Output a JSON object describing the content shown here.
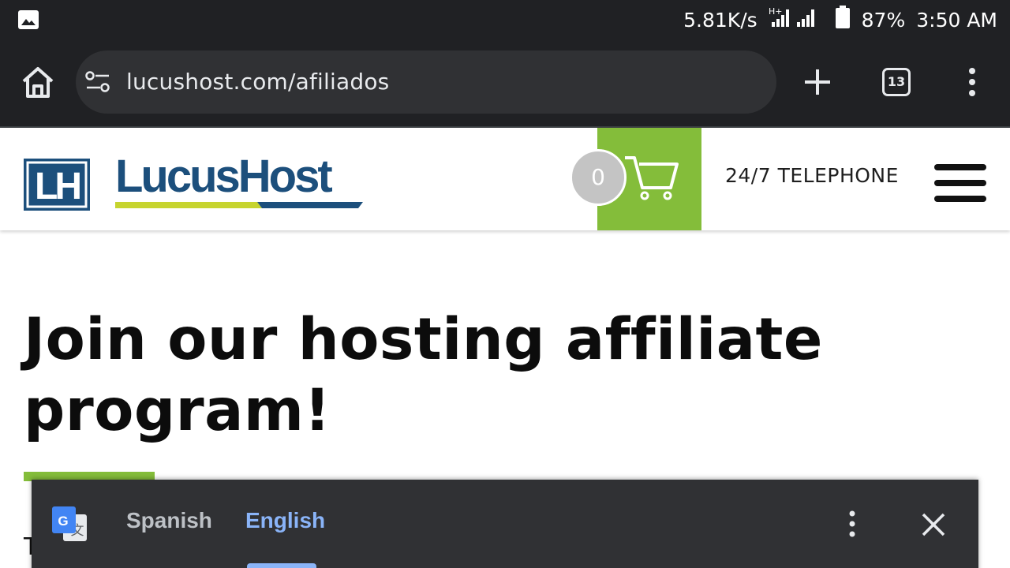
{
  "status_bar": {
    "network_speed": "5.81K/s",
    "network_type": "H+",
    "battery": "87%",
    "time": "3:50 AM"
  },
  "browser": {
    "url": "lucushost.com/afiliados",
    "tab_count": "13"
  },
  "site_header": {
    "logo_monogram": "LH",
    "logo_text": "LucusHost",
    "cart_count": "0",
    "phone_label": "24/7 TELEPHONE"
  },
  "main": {
    "title": "Join our hosting affiliate program!",
    "body_peek": "T"
  },
  "translate_bar": {
    "source_language": "Spanish",
    "target_language": "English"
  },
  "colors": {
    "brand_blue": "#1c4f7c",
    "brand_green": "#84bd3a",
    "brand_lime": "#c6d42f",
    "chrome_dark": "#202124",
    "translate_accent": "#8ab4f8"
  },
  "icons": {
    "status_image": "image-icon",
    "home": "home-icon",
    "site_settings": "tune-icon",
    "new_tab": "plus-icon",
    "overflow": "more-vertical-icon",
    "cart": "cart-icon",
    "menu": "hamburger-icon",
    "translate": "google-translate-icon",
    "close": "close-icon"
  }
}
